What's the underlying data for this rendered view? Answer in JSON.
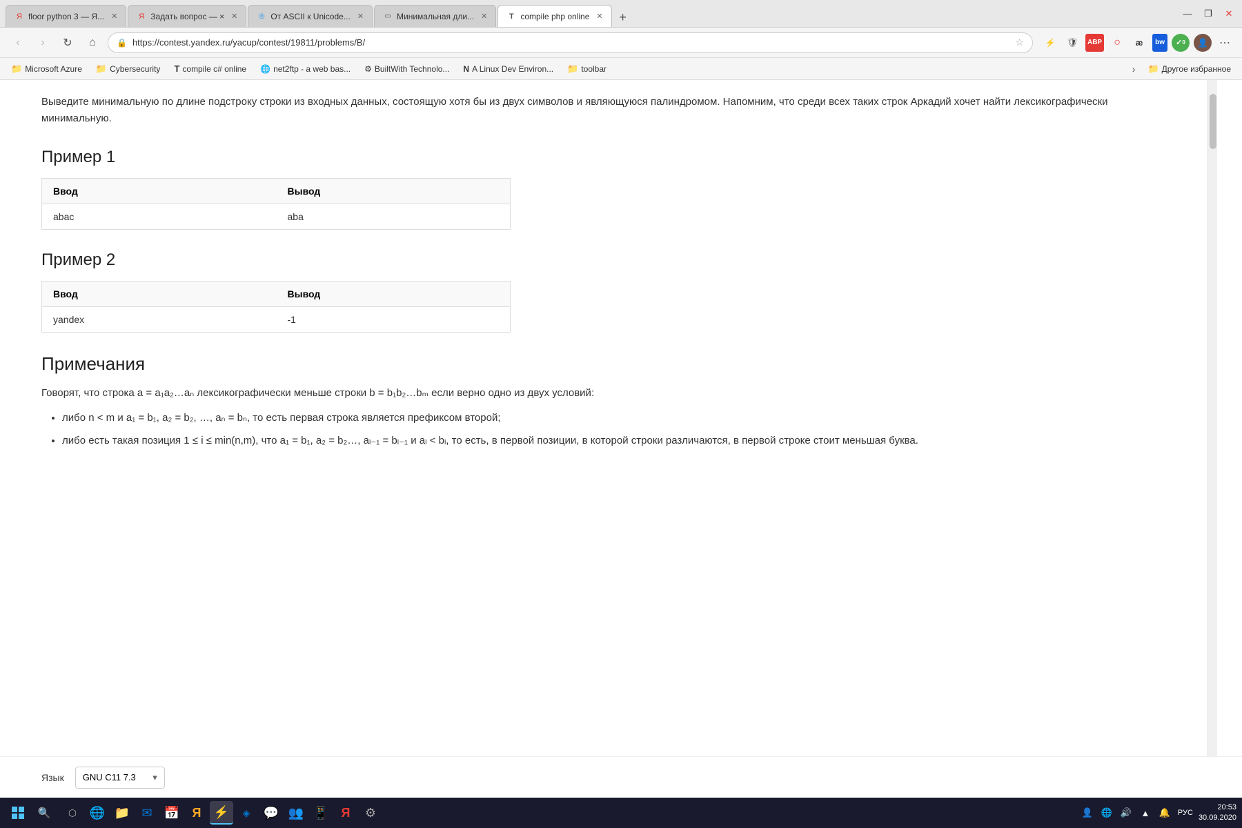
{
  "browser": {
    "tabs": [
      {
        "id": "tab1",
        "favicon": "Я",
        "favicon_color": "#e53935",
        "title": "floor python 3 — Я...",
        "active": false
      },
      {
        "id": "tab2",
        "favicon": "Я",
        "favicon_color": "#e53935",
        "title": "Задать вопрос — ×",
        "active": false
      },
      {
        "id": "tab3",
        "favicon": "◌",
        "favicon_color": "#2196F3",
        "title": "От ASCII к Unicode...",
        "active": false
      },
      {
        "id": "tab4",
        "favicon": "□",
        "favicon_color": "#555",
        "title": "Минимальная дли...",
        "active": false
      },
      {
        "id": "tab5",
        "favicon": "T",
        "favicon_color": "#555",
        "title": "compile php online",
        "active": true
      }
    ],
    "address": "https://contest.yandex.ru/yacup/contest/19811/problems/B/",
    "nav_icons": [
      "★",
      "⚡",
      "🛡",
      "ABP",
      "○",
      "æ",
      "bw",
      "✓"
    ]
  },
  "bookmarks": [
    {
      "label": "Microsoft Azure",
      "icon": "📁"
    },
    {
      "label": "Cybersecurity",
      "icon": "📁"
    },
    {
      "label": "compile c# online",
      "icon": "T"
    },
    {
      "label": "net2ftp - a web bas...",
      "icon": "🌐"
    },
    {
      "label": "BuiltWith Technolo...",
      "icon": "⚙"
    },
    {
      "label": "A Linux Dev Environ...",
      "icon": "N"
    },
    {
      "label": "toolbar",
      "icon": "📁"
    }
  ],
  "bookmarks_other": "Другое избранное",
  "page": {
    "intro_text": "Выведите минимальную по длине подстроку строки из входных данных, состоящую хотя бы из двух символов и являющуюся палиндромом. Напомним, что среди всех таких строк Аркадий хочет найти лексикографически минимальную.",
    "example1": {
      "title": "Пример 1",
      "input_header": "Ввод",
      "output_header": "Вывод",
      "input_value": "abac",
      "output_value": "aba"
    },
    "example2": {
      "title": "Пример 2",
      "input_header": "Ввод",
      "output_header": "Вывод",
      "input_value": "yandex",
      "output_value": "-1"
    },
    "notes": {
      "title": "Примечания",
      "intro": "Говорят, что строка a = a₁a₂…aₙ лексикографически меньше строки b = b₁b₂…bₘ если верно одно из двух условий:",
      "bullet1": "либо n < m и a₁ = b₁, a₂ = b₂, …, aₙ = bₙ, то есть первая строка является префиксом второй;",
      "bullet2": "либо есть такая позиция 1 ≤ i ≤ min(n,m), что a₁ = b₁, a₂ = b₂…, aᵢ₋₁ = bᵢ₋₁ и aᵢ < bᵢ, то есть, в первой позиции, в которой строки различаются, в первой строке стоит меньшая буква."
    },
    "language_label": "Язык",
    "language_value": "GNU C11 7.3"
  },
  "taskbar": {
    "time": "20:53",
    "date": "30.09.2020",
    "lang": "РУС"
  }
}
